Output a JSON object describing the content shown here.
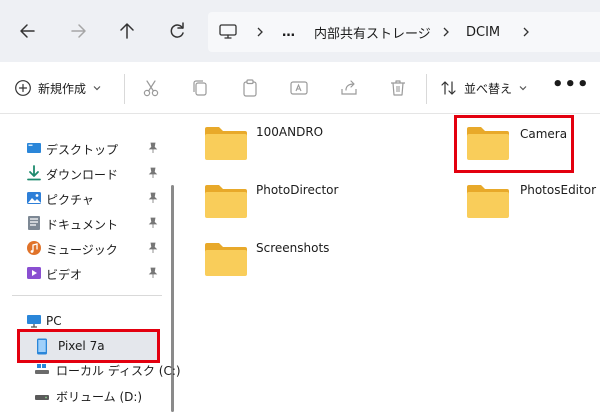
{
  "nav": {
    "back_icon": "arrow-left-icon",
    "forward_icon": "arrow-right-icon",
    "up_icon": "arrow-up-icon",
    "refresh_icon": "refresh-icon",
    "address": {
      "computer_icon": "monitor-icon",
      "ellipsis": "…",
      "crumbs": [
        "内部共有ストレージ",
        "DCIM"
      ]
    }
  },
  "toolbar": {
    "new_label": "新規作成",
    "sort_label": "並べ替え",
    "more_label": "•••",
    "icons": [
      "cut-icon",
      "copy-icon",
      "paste-icon",
      "rename-icon",
      "share-icon",
      "delete-icon"
    ]
  },
  "sidebar": {
    "quick_access": [
      {
        "label": "デスクトップ",
        "icon": "desktop-icon",
        "pinned": true
      },
      {
        "label": "ダウンロード",
        "icon": "download-icon",
        "pinned": true
      },
      {
        "label": "ピクチャ",
        "icon": "pictures-icon",
        "pinned": true
      },
      {
        "label": "ドキュメント",
        "icon": "documents-icon",
        "pinned": true
      },
      {
        "label": "ミュージック",
        "icon": "music-icon",
        "pinned": true
      },
      {
        "label": "ビデオ",
        "icon": "videos-icon",
        "pinned": true
      }
    ],
    "devices": [
      {
        "label": "PC",
        "icon": "pc-icon"
      },
      {
        "label": "Pixel 7a",
        "icon": "phone-icon",
        "selected": true
      },
      {
        "label": "ローカル ディスク (C:)",
        "icon": "drive-icon"
      },
      {
        "label": "ボリューム (D:)",
        "icon": "drive-icon"
      }
    ]
  },
  "folders": [
    {
      "name": "100ANDRO"
    },
    {
      "name": "Camera",
      "highlighted": true
    },
    {
      "name": "PhotoDirector"
    },
    {
      "name": "PhotosEditor"
    },
    {
      "name": "Screenshots"
    }
  ],
  "colors": {
    "highlight": "#e3000f",
    "folder": "#f6c543",
    "accent": "#0a64c8"
  }
}
